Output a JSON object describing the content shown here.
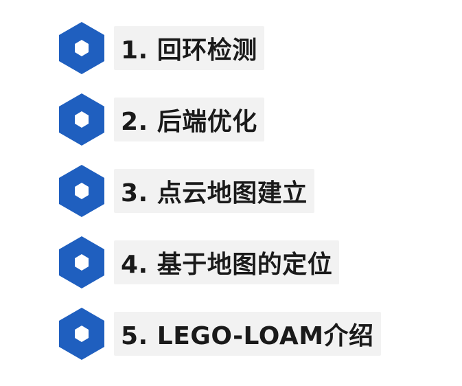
{
  "items": [
    {
      "label": "1. 回环检测",
      "icon": "hexagon-icon"
    },
    {
      "label": "2. 后端优化",
      "icon": "hexagon-icon"
    },
    {
      "label": "3. 点云地图建立",
      "icon": "hexagon-icon"
    },
    {
      "label": "4. 基于地图的定位",
      "icon": "hexagon-icon"
    },
    {
      "label": "5. LEGO-LOAM介绍",
      "icon": "hexagon-icon"
    }
  ],
  "colors": {
    "hexagon_blue": "#1f5fbf",
    "hexagon_inner": "#ffffff",
    "label_bg": "#f2f2f2",
    "text": "#1a1a1a"
  }
}
